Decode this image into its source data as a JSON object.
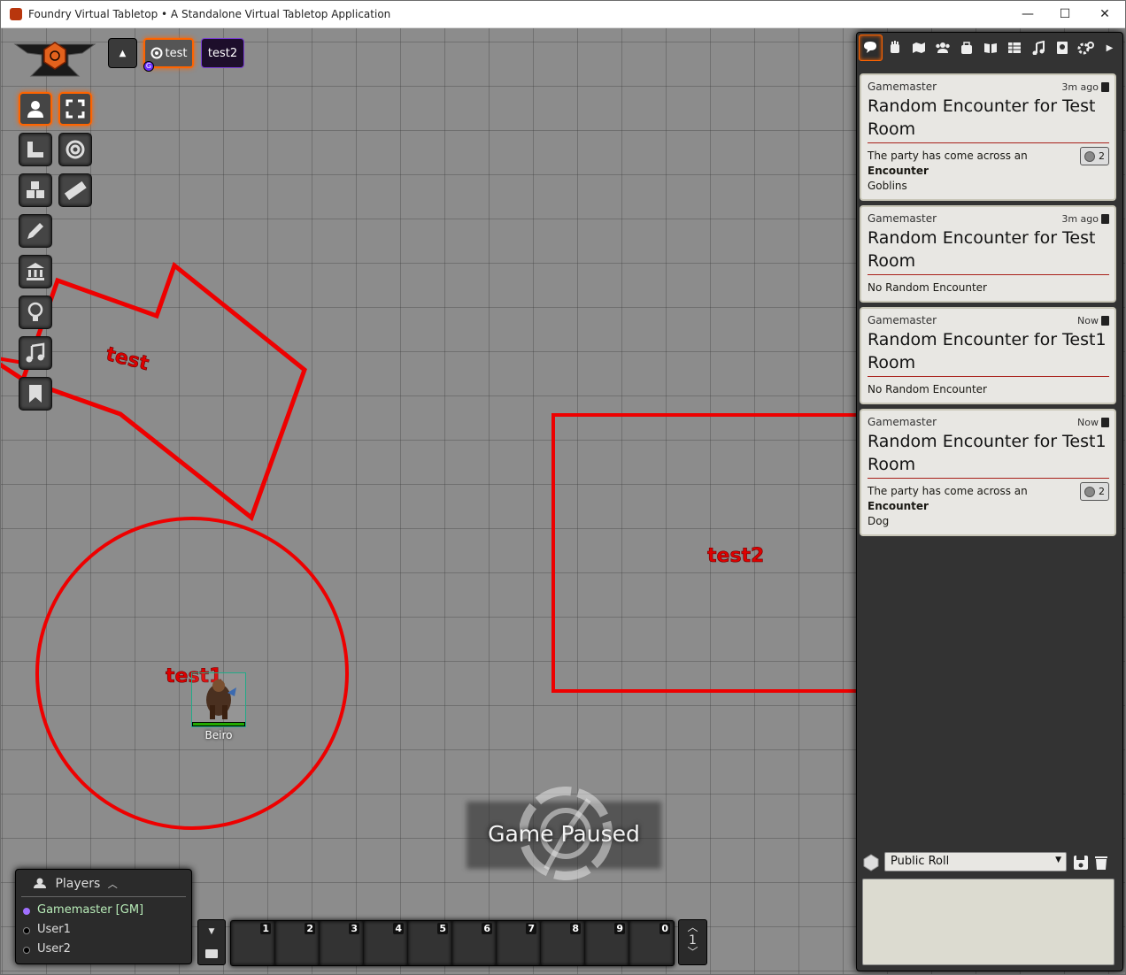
{
  "window": {
    "title": "Foundry Virtual Tabletop • A Standalone Virtual Tabletop Application",
    "controls": {
      "minimize": "—",
      "maximize": "☐",
      "close": "✕"
    }
  },
  "scene_nav": {
    "collapse_icon": "▲",
    "scenes": [
      {
        "label": "test",
        "active": true
      },
      {
        "label": "test2",
        "active": false
      }
    ],
    "user_marker": "G"
  },
  "scene_controls": {
    "icons": [
      "user-icon",
      "expand-icon",
      "ruler-icon",
      "target-icon",
      "cubes-icon",
      "measure-icon",
      "pencil-icon",
      "landmark-icon",
      "lightbulb-icon",
      "music-icon",
      "bookmark-icon"
    ]
  },
  "canvas": {
    "drawings": [
      {
        "label": "test",
        "shape": "polygon"
      },
      {
        "label": "test1",
        "shape": "circle"
      },
      {
        "label": "test2",
        "shape": "rectangle"
      }
    ],
    "token": {
      "name": "Beiro"
    }
  },
  "pause": {
    "text": "Game Paused"
  },
  "sidebar": {
    "tabs": [
      "chat-icon",
      "combat-icon",
      "scenes-icon",
      "actors-icon",
      "items-icon",
      "journal-icon",
      "tables-icon",
      "playlists-icon",
      "compendium-icon",
      "settings-icon",
      "collapse-icon"
    ],
    "messages": [
      {
        "speaker": "Gamemaster",
        "time": "3m ago",
        "title": "Random Encounter for Test Room",
        "body_prefix": "The party has come across an ",
        "body_bold": "Encounter",
        "result": "Goblins",
        "roll": "2"
      },
      {
        "speaker": "Gamemaster",
        "time": "3m ago",
        "title": "Random Encounter for Test Room",
        "body_prefix": "No Random Encounter",
        "body_bold": "",
        "result": "",
        "roll": ""
      },
      {
        "speaker": "Gamemaster",
        "time": "Now",
        "title": "Random Encounter for Test1 Room",
        "body_prefix": "No Random Encounter",
        "body_bold": "",
        "result": "",
        "roll": ""
      },
      {
        "speaker": "Gamemaster",
        "time": "Now",
        "title": "Random Encounter for Test1 Room",
        "body_prefix": "The party has come across an ",
        "body_bold": "Encounter",
        "result": "Dog",
        "roll": "2"
      }
    ],
    "roll_mode": "Public Roll"
  },
  "players": {
    "title": "Players",
    "list": [
      {
        "name": "Gamemaster [GM]",
        "color": "#a070ff",
        "active": true
      },
      {
        "name": "User1",
        "color": "#000000",
        "active": false
      },
      {
        "name": "User2",
        "color": "#000000",
        "active": false
      }
    ]
  },
  "hotbar": {
    "slots": [
      "1",
      "2",
      "3",
      "4",
      "5",
      "6",
      "7",
      "8",
      "9",
      "0"
    ],
    "page": "1"
  }
}
